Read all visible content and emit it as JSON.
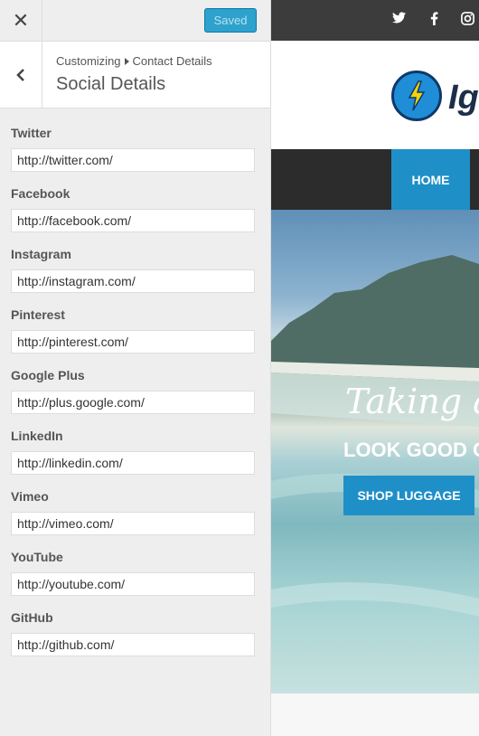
{
  "customizer": {
    "close_icon": "close-icon",
    "save_label": "Saved",
    "breadcrumb": {
      "root": "Customizing",
      "parent": "Contact Details"
    },
    "section_title": "Social Details",
    "fields": [
      {
        "label": "Twitter",
        "value": "http://twitter.com/"
      },
      {
        "label": "Facebook",
        "value": "http://facebook.com/"
      },
      {
        "label": "Instagram",
        "value": "http://instagram.com/"
      },
      {
        "label": "Pinterest",
        "value": "http://pinterest.com/"
      },
      {
        "label": "Google Plus",
        "value": "http://plus.google.com/"
      },
      {
        "label": "LinkedIn",
        "value": "http://linkedin.com/"
      },
      {
        "label": "Vimeo",
        "value": "http://vimeo.com/"
      },
      {
        "label": "YouTube",
        "value": "http://youtube.com/"
      },
      {
        "label": "GitHub",
        "value": "http://github.com/"
      }
    ]
  },
  "preview": {
    "social_icons": [
      "twitter-icon",
      "facebook-icon",
      "instagram-icon"
    ],
    "logo_text": "Ig",
    "nav_home": "HOME",
    "hero_title": "Taking a",
    "hero_subtitle": "LOOK GOOD O",
    "hero_button": "SHOP LUGGAGE"
  },
  "colors": {
    "accent": "#2ea2cc",
    "nav_active": "#1f8fc8",
    "topbar_dark": "#3c3c3c"
  }
}
